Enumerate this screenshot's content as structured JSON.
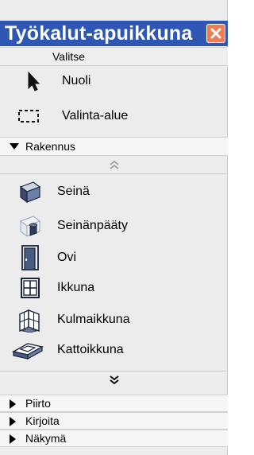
{
  "palette": {
    "title": "Työkalut-apuikkuna",
    "close_symbol": "×",
    "colors": {
      "titlebar": "#2e57b3",
      "close_button": "#ee7d52",
      "panel": "#ececec"
    },
    "sections": {
      "valitse": {
        "label": "Valitse",
        "tools": [
          {
            "label": "Nuoli",
            "icon": "arrow-pointer-icon"
          },
          {
            "label": "Valinta-alue",
            "icon": "marquee-selection-icon"
          }
        ]
      },
      "rakennus": {
        "label": "Rakennus",
        "expanded": true,
        "tools": [
          {
            "label": "Seinä",
            "icon": "wall-icon"
          },
          {
            "label": "Seinänpääty",
            "icon": "wall-end-icon"
          },
          {
            "label": "Ovi",
            "icon": "door-icon"
          },
          {
            "label": "Ikkuna",
            "icon": "window-icon"
          },
          {
            "label": "Kulmaikkuna",
            "icon": "corner-window-icon"
          },
          {
            "label": "Kattoikkuna",
            "icon": "skylight-icon"
          }
        ]
      },
      "collapsed": [
        {
          "label": "Piirto",
          "expanded": false
        },
        {
          "label": "Kirjoita",
          "expanded": false
        },
        {
          "label": "Näkymä",
          "expanded": false
        }
      ]
    }
  }
}
